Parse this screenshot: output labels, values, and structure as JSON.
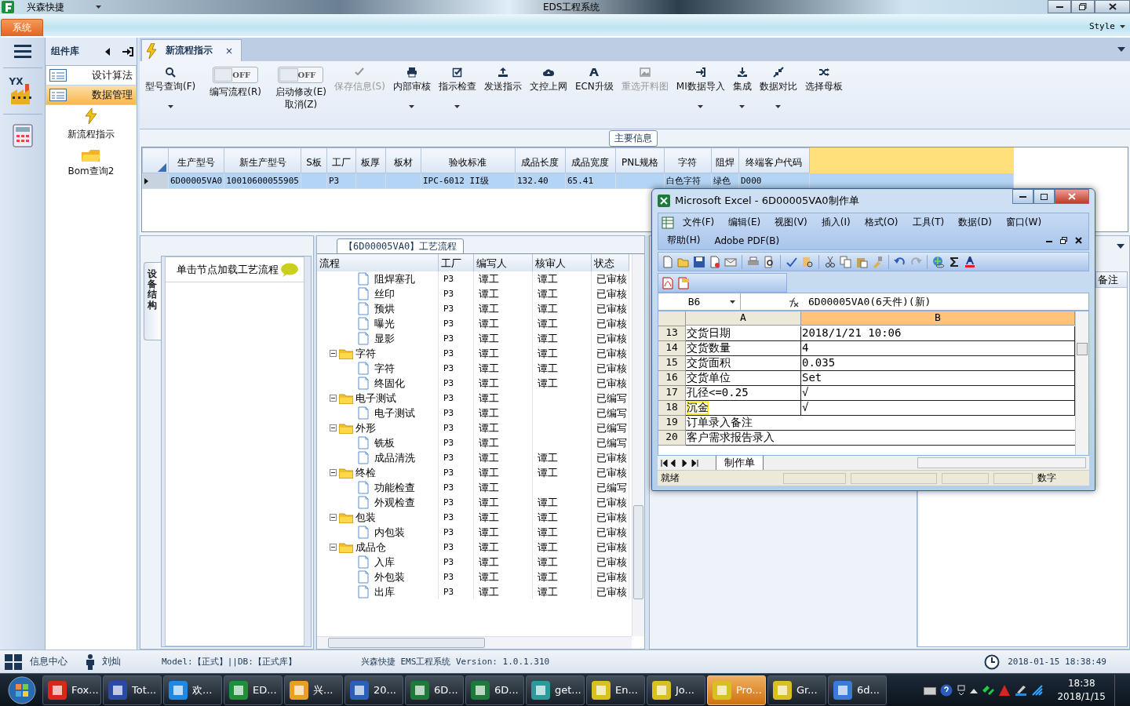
{
  "window": {
    "app_name": "兴森快捷",
    "title": "EDS工程系统"
  },
  "ribbon": {
    "tabs": [
      {
        "label": "系统",
        "selected": true
      }
    ],
    "style_menu": "Style"
  },
  "nav_rail": {
    "logo_text": "YX"
  },
  "nav_panel": {
    "title": "组件库",
    "items": [
      {
        "kind": "row",
        "label": "设计算法",
        "selected": false
      },
      {
        "kind": "row",
        "label": "数据管理",
        "selected": true
      },
      {
        "kind": "tile",
        "label": "新流程指示",
        "selected": false
      },
      {
        "kind": "tile",
        "label": "Bom查询2",
        "selected": false
      }
    ]
  },
  "document_tabs": [
    {
      "label": "新流程指示",
      "selected": true,
      "close": "×"
    }
  ],
  "toolbar": [
    {
      "kind": "button",
      "label": "型号查询(F)",
      "dropdown": true,
      "disabled": false
    },
    {
      "kind": "toggle",
      "label": "编写流程(R)",
      "switch_text": "OFF",
      "on": false
    },
    {
      "kind": "toggle",
      "label": "启动修改(E)\n取消(Z)",
      "switch_text": "OFF",
      "on": false
    },
    {
      "kind": "button",
      "label": "保存信息(S)",
      "dropdown": false,
      "disabled": true
    },
    {
      "kind": "button",
      "label": "内部审核",
      "dropdown": true,
      "disabled": false
    },
    {
      "kind": "button",
      "label": "指示检查",
      "dropdown": true,
      "disabled": false
    },
    {
      "kind": "button",
      "label": "发送指示",
      "dropdown": false,
      "disabled": false
    },
    {
      "kind": "button",
      "label": "文控上网",
      "dropdown": false,
      "disabled": false
    },
    {
      "kind": "button",
      "label": "ECN升级",
      "dropdown": false,
      "disabled": false
    },
    {
      "kind": "button",
      "label": "重选开料图",
      "dropdown": false,
      "disabled": true
    },
    {
      "kind": "button",
      "label": "MI数据导入",
      "dropdown": true,
      "disabled": false
    },
    {
      "kind": "button",
      "label": "集成",
      "dropdown": true,
      "disabled": false
    },
    {
      "kind": "button",
      "label": "数据对比",
      "dropdown": true,
      "disabled": false
    },
    {
      "kind": "button",
      "label": "选择母板",
      "dropdown": false,
      "disabled": false
    }
  ],
  "main_info": {
    "title": "主要信息",
    "columns": [
      "生产型号",
      "新生产型号",
      "S板",
      "工厂",
      "板厚",
      "板材",
      "验收标准",
      "成品长度",
      "成品宽度",
      "PNL规格",
      "字符",
      "阻焊",
      "终端客户代码"
    ],
    "rows": [
      {
        "selected": true,
        "cells": [
          "6D00005VA0",
          "10010600055905",
          null,
          "P3",
          null,
          null,
          "IPC-6012 II级",
          "132.40",
          "65.41",
          null,
          "白色字符",
          "绿色",
          "D000"
        ]
      }
    ]
  },
  "structure_panel": {
    "tab": "设备结构",
    "hint": "单击节点加载工艺流程"
  },
  "process": {
    "title": "【6D00005VA0】工艺流程",
    "columns": [
      "流程",
      "工厂",
      "编写人",
      "核审人",
      "状态"
    ],
    "nodes": [
      {
        "kind": "leaf",
        "label": "阻焊塞孔",
        "factory": "P3",
        "writer": "谭工",
        "reviewer": "谭工",
        "status": "已审核"
      },
      {
        "kind": "leaf",
        "label": "丝印",
        "factory": "P3",
        "writer": "谭工",
        "reviewer": "谭工",
        "status": "已审核"
      },
      {
        "kind": "leaf",
        "label": "预烘",
        "factory": "P3",
        "writer": "谭工",
        "reviewer": "谭工",
        "status": "已审核"
      },
      {
        "kind": "leaf",
        "label": "曝光",
        "factory": "P3",
        "writer": "谭工",
        "reviewer": "谭工",
        "status": "已审核"
      },
      {
        "kind": "leaf",
        "label": "显影",
        "factory": "P3",
        "writer": "谭工",
        "reviewer": "谭工",
        "status": "已审核"
      },
      {
        "kind": "folder",
        "label": "字符",
        "factory": "P3",
        "writer": "谭工",
        "reviewer": "谭工",
        "status": "已审核",
        "expanded": true,
        "children": [
          {
            "kind": "leaf",
            "label": "字符",
            "factory": "P3",
            "writer": "谭工",
            "reviewer": "谭工",
            "status": "已审核"
          },
          {
            "kind": "leaf",
            "label": "终固化",
            "factory": "P3",
            "writer": "谭工",
            "reviewer": "谭工",
            "status": "已审核"
          }
        ]
      },
      {
        "kind": "folder",
        "label": "电子测试",
        "factory": "P3",
        "writer": "谭工",
        "status": "已编写",
        "expanded": true,
        "children": [
          {
            "kind": "leaf",
            "label": "电子测试",
            "factory": "P3",
            "writer": "谭工",
            "status": "已编写"
          }
        ]
      },
      {
        "kind": "folder",
        "label": "外形",
        "factory": "P3",
        "writer": "谭工",
        "status": "已编写",
        "expanded": true,
        "children": [
          {
            "kind": "leaf",
            "label": "铣板",
            "factory": "P3",
            "writer": "谭工",
            "status": "已编写"
          },
          {
            "kind": "leaf",
            "label": "成品清洗",
            "factory": "P3",
            "writer": "谭工",
            "reviewer": "谭工",
            "status": "已审核"
          }
        ]
      },
      {
        "kind": "folder",
        "label": "终检",
        "factory": "P3",
        "writer": "谭工",
        "reviewer": "谭工",
        "status": "已审核",
        "expanded": true,
        "children": [
          {
            "kind": "leaf",
            "label": "功能检查",
            "factory": "P3",
            "writer": "谭工",
            "status": "已编写"
          },
          {
            "kind": "leaf",
            "label": "外观检查",
            "factory": "P3",
            "writer": "谭工",
            "reviewer": "谭工",
            "status": "已审核"
          }
        ]
      },
      {
        "kind": "folder",
        "label": "包装",
        "factory": "P3",
        "writer": "谭工",
        "reviewer": "谭工",
        "status": "已审核",
        "expanded": true,
        "children": [
          {
            "kind": "leaf",
            "label": "内包装",
            "factory": "P3",
            "writer": "谭工",
            "reviewer": "谭工",
            "status": "已审核"
          }
        ]
      },
      {
        "kind": "folder",
        "label": "成品仓",
        "factory": "P3",
        "writer": "谭工",
        "reviewer": "谭工",
        "status": "已审核",
        "expanded": true,
        "children": [
          {
            "kind": "leaf",
            "label": "入库",
            "factory": "P3",
            "writer": "谭工",
            "reviewer": "谭工",
            "status": "已审核"
          },
          {
            "kind": "leaf",
            "label": "外包装",
            "factory": "P3",
            "writer": "谭工",
            "reviewer": "谭工",
            "status": "已审核"
          },
          {
            "kind": "leaf",
            "label": "出库",
            "factory": "P3",
            "writer": "谭工",
            "reviewer": "谭工",
            "status": "已审核"
          }
        ]
      }
    ]
  },
  "notes_panel": {
    "columns": [
      "备注"
    ]
  },
  "excel": {
    "title": "Microsoft Excel - 6D00005VA0制作单",
    "menus": [
      "文件(F)",
      "编辑(E)",
      "视图(V)",
      "插入(I)",
      "格式(O)",
      "工具(T)",
      "数据(D)",
      "窗口(W)",
      "帮助(H)",
      "Adobe PDF(B)"
    ],
    "name_box": "B6",
    "formula": "6D00005VA0(6天件)(新)",
    "columns": [
      {
        "label": "A",
        "selected": false
      },
      {
        "label": "B",
        "selected": true
      }
    ],
    "rows": [
      {
        "number": "13",
        "a": "交货日期",
        "b": "2018/1/21 10:06",
        "highlighted": false
      },
      {
        "number": "14",
        "a": "交货数量",
        "b": "4",
        "highlighted": false
      },
      {
        "number": "15",
        "a": "交货面积",
        "b": "0.035",
        "highlighted": false
      },
      {
        "number": "16",
        "a": "交货单位",
        "b": "Set",
        "highlighted": false
      },
      {
        "number": "17",
        "a": "孔径<=0.25",
        "b": "√",
        "highlighted": false
      },
      {
        "number": "18",
        "a": "沉金",
        "b": "√",
        "highlighted": true
      },
      {
        "number": "19",
        "a": "订单录入备注",
        "highlighted": false
      },
      {
        "number": "20",
        "a": "客户需求报告录入",
        "highlighted": false
      }
    ],
    "sheet_tabs": [
      {
        "label": "制作单",
        "selected": true
      }
    ],
    "status": "就绪",
    "indicator": "数字"
  },
  "status_bar": {
    "info_center": "信息中心",
    "user": "刘灿",
    "model": "Model:【正式】||DB:【正式库】",
    "version": "兴森快捷 EMS工程系统 Version: 1.0.1.310",
    "datetime": "2018-01-15 18:38:49"
  },
  "taskbar": {
    "items": [
      {
        "label": "Fox...",
        "selected": false
      },
      {
        "label": "Tot...",
        "selected": false
      },
      {
        "label": "欢...",
        "selected": false
      },
      {
        "label": "ED...",
        "selected": false
      },
      {
        "label": "兴...",
        "selected": false
      },
      {
        "label": "20...",
        "selected": false
      },
      {
        "label": "6D...",
        "selected": false
      },
      {
        "label": "6D...",
        "selected": false
      },
      {
        "label": "get...",
        "selected": false
      },
      {
        "label": "En...",
        "selected": false
      },
      {
        "label": "Jo...",
        "selected": false
      },
      {
        "label": "Pro...",
        "selected": true
      },
      {
        "label": "Gr...",
        "selected": false
      },
      {
        "label": "6d...",
        "selected": false
      }
    ],
    "time": "18:38",
    "date": "2018/1/15"
  }
}
